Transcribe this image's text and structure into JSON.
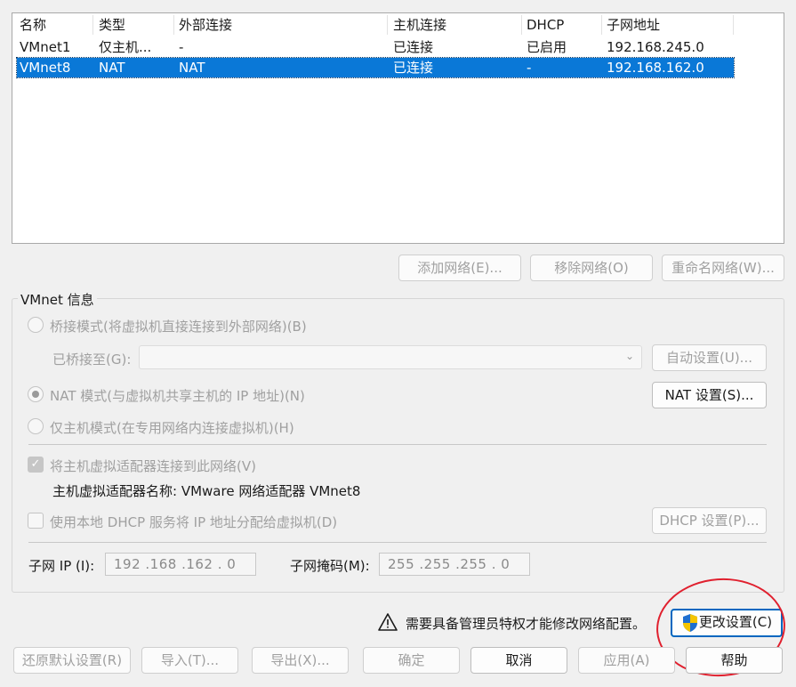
{
  "network_list": {
    "columns": [
      "名称",
      "类型",
      "外部连接",
      "主机连接",
      "DHCP",
      "子网地址"
    ],
    "rows": [
      {
        "name": "VMnet1",
        "type": "仅主机...",
        "external": "-",
        "host": "已连接",
        "dhcp": "已启用",
        "subnet": "192.168.245.0",
        "selected": false
      },
      {
        "name": "VMnet8",
        "type": "NAT",
        "external": "NAT",
        "host": "已连接",
        "dhcp": "-",
        "subnet": "192.168.162.0",
        "selected": true
      }
    ]
  },
  "list_buttons": {
    "add": "添加网络(E)...",
    "remove": "移除网络(O)",
    "rename": "重命名网络(W)..."
  },
  "vmnet_info": {
    "title": "VMnet 信息",
    "bridge_mode": "桥接模式(将虚拟机直接连接到外部网络)(B)",
    "bridged_to_label": "已桥接至(G):",
    "bridged_to_value": "",
    "auto_settings": "自动设置(U)...",
    "nat_mode": "NAT 模式(与虚拟机共享主机的 IP 地址)(N)",
    "nat_settings": "NAT 设置(S)...",
    "host_only_mode": "仅主机模式(在专用网络内连接虚拟机)(H)",
    "connect_adapter": "将主机虚拟适配器连接到此网络(V)",
    "adapter_name": "主机虚拟适配器名称: VMware 网络适配器 VMnet8",
    "use_dhcp": "使用本地 DHCP 服务将 IP 地址分配给虚拟机(D)",
    "dhcp_settings": "DHCP 设置(P)...",
    "subnet_ip_label": "子网 IP (I):",
    "subnet_ip_value": "192 .168 .162 .  0",
    "subnet_mask_label": "子网掩码(M):",
    "subnet_mask_value": "255 .255 .255 .  0",
    "selected_mode": "nat"
  },
  "admin": {
    "warning": "需要具备管理员特权才能修改网络配置。",
    "change_settings": "更改设置(C)"
  },
  "footer_buttons": {
    "restore_defaults": "还原默认设置(R)",
    "import": "导入(T)...",
    "export": "导出(X)...",
    "ok": "确定",
    "cancel": "取消",
    "apply": "应用(A)",
    "help": "帮助"
  },
  "colors": {
    "selection": "#0a78d7",
    "annotation": "#e0202e"
  }
}
